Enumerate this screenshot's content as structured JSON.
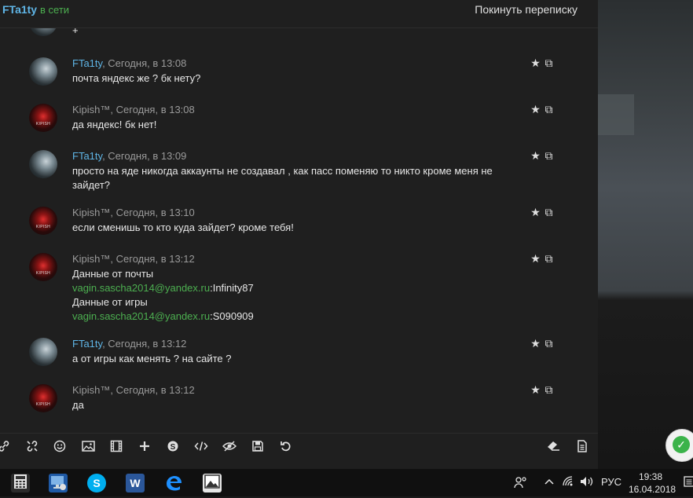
{
  "header": {
    "user": "FTa1ty",
    "status": "в сети",
    "leave": "Покинуть переписку"
  },
  "partial_top_text": "+",
  "messages": [
    {
      "author": "FTa1ty",
      "time": ", Сегодня, в 13:08",
      "avatar": "fta",
      "lines": [
        "почта яндекс же ? бк нету?"
      ]
    },
    {
      "author": "Kipish™",
      "time": ", Сегодня, в 13:08",
      "avatar": "kip",
      "lines": [
        "да яндекс! бк нет!"
      ]
    },
    {
      "author": "FTa1ty",
      "time": ", Сегодня, в 13:09",
      "avatar": "fta",
      "lines": [
        "просто на яде никогда аккаунты не создавал , как пасс поменяю то никто кроме меня не зайдет?"
      ]
    },
    {
      "author": "Kipish™",
      "time": ", Сегодня, в 13:10",
      "avatar": "kip",
      "lines": [
        "если сменишь то кто куда зайдет? кроме тебя!"
      ]
    },
    {
      "author": "Kipish™",
      "time": ", Сегодня, в 13:12",
      "avatar": "kip",
      "line1": "Данные от почты",
      "email1": "vagin.sascha2014@yandex.ru",
      "pass1": ":Infinity87",
      "line3": "Данные от игры",
      "email2": "vagin.sascha2014@yandex.ru",
      "pass2": ":S090909"
    },
    {
      "author": "FTa1ty",
      "time": ", Сегодня, в 13:12",
      "avatar": "fta",
      "lines": [
        "а от игры как менять ? на сайте ?"
      ]
    },
    {
      "author": "Kipish™",
      "time": ", Сегодня, в 13:12",
      "avatar": "kip",
      "lines": [
        "да"
      ]
    }
  ],
  "message_actions": {
    "star": "★",
    "copy": "⧉"
  },
  "toolbar_icons": [
    "link-icon",
    "unlink-icon",
    "smiley-icon",
    "image-icon",
    "video-icon",
    "plus-icon",
    "skype-icon",
    "code-icon",
    "hide-icon",
    "save-icon",
    "undo-icon",
    "eraser-icon",
    "document-icon"
  ],
  "taskbar": {
    "apps": [
      "calculator",
      "network-manager",
      "skype",
      "word",
      "edge",
      "photos"
    ],
    "lang": "РУС",
    "time": "19:38",
    "date": "16.04.2018"
  },
  "colors": {
    "accent_blue": "#5fb5e6",
    "online_green": "#4caf50",
    "link_green": "#4caf50",
    "bg": "#1f1f1f"
  }
}
